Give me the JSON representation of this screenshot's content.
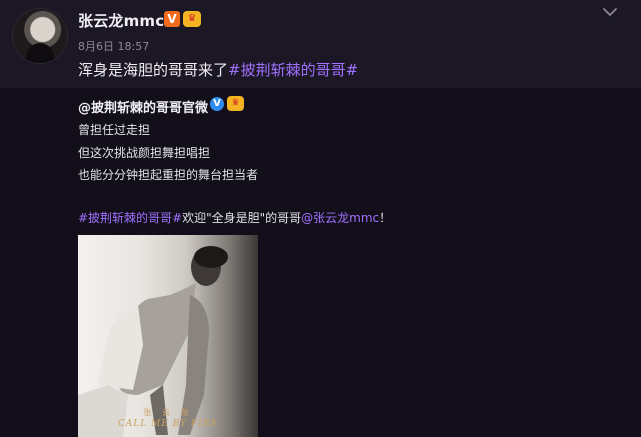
{
  "post": {
    "username": "张云龙mmc",
    "verified_badge": "V",
    "timestamp": "8月6日 18:57",
    "text_prefix": "浑身是海胆的哥哥来了",
    "hashtag": "#披荆斩棘的哥哥#",
    "menu_icon": "chevron-down-icon"
  },
  "repost": {
    "author": "@披荆斩棘的哥哥官微",
    "verified_badge": "V",
    "lines": [
      "曾担任过走担",
      "但这次挑战颜担舞担唱担",
      "也能分分钟担起重担的舞台担当者"
    ],
    "hashtag": "#披荆斩棘的哥哥#",
    "middle_text": "欢迎\"全身是胆\"的哥哥",
    "mention": "@张云龙mmc",
    "end_text": "！",
    "poster_name": "张 云 龙",
    "poster_tagline": "CALL ME BY FIRE"
  },
  "colors": {
    "background": "#16121f",
    "hashtag": "#a070ff",
    "badge_orange": "#f26b1d",
    "badge_blue": "#2e8cf0"
  }
}
